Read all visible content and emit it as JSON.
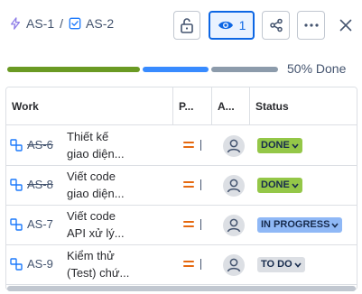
{
  "breadcrumbs": [
    {
      "key": "AS-1",
      "icon": "epic-bolt-icon",
      "color": "#8f7ee7"
    },
    {
      "key": "AS-2",
      "icon": "task-check-icon",
      "color": "#1d7afc"
    }
  ],
  "separator": "/",
  "header": {
    "watch_count": "1"
  },
  "progress": {
    "label": "50% Done",
    "segments": [
      {
        "name": "done",
        "fraction": 0.5,
        "color": "#6a9a23"
      },
      {
        "name": "in-progress",
        "fraction": 0.25,
        "color": "#388bff"
      },
      {
        "name": "to-do",
        "fraction": 0.25,
        "color": "#8c9bab"
      }
    ]
  },
  "table": {
    "columns": [
      "Work",
      "P...",
      "A...",
      "Status"
    ],
    "rows": [
      {
        "key": "AS-6",
        "done": true,
        "summary_line1": "Thiết kế",
        "summary_line2": "giao diện...",
        "status": "DONE",
        "status_color": "#94c748"
      },
      {
        "key": "AS-8",
        "done": true,
        "summary_line1": "Viết code",
        "summary_line2": "giao diện...",
        "status": "DONE",
        "status_color": "#94c748"
      },
      {
        "key": "AS-7",
        "done": false,
        "summary_line1": "Viết code",
        "summary_line2": "API xử lý...",
        "status": "IN PROGRESS",
        "status_color": "#8fb8f6"
      },
      {
        "key": "AS-9",
        "done": false,
        "summary_line1": "Kiểm thử",
        "summary_line2": "(Test) chứ...",
        "status": "TO DO",
        "status_color": "#dcdfe4"
      }
    ]
  }
}
